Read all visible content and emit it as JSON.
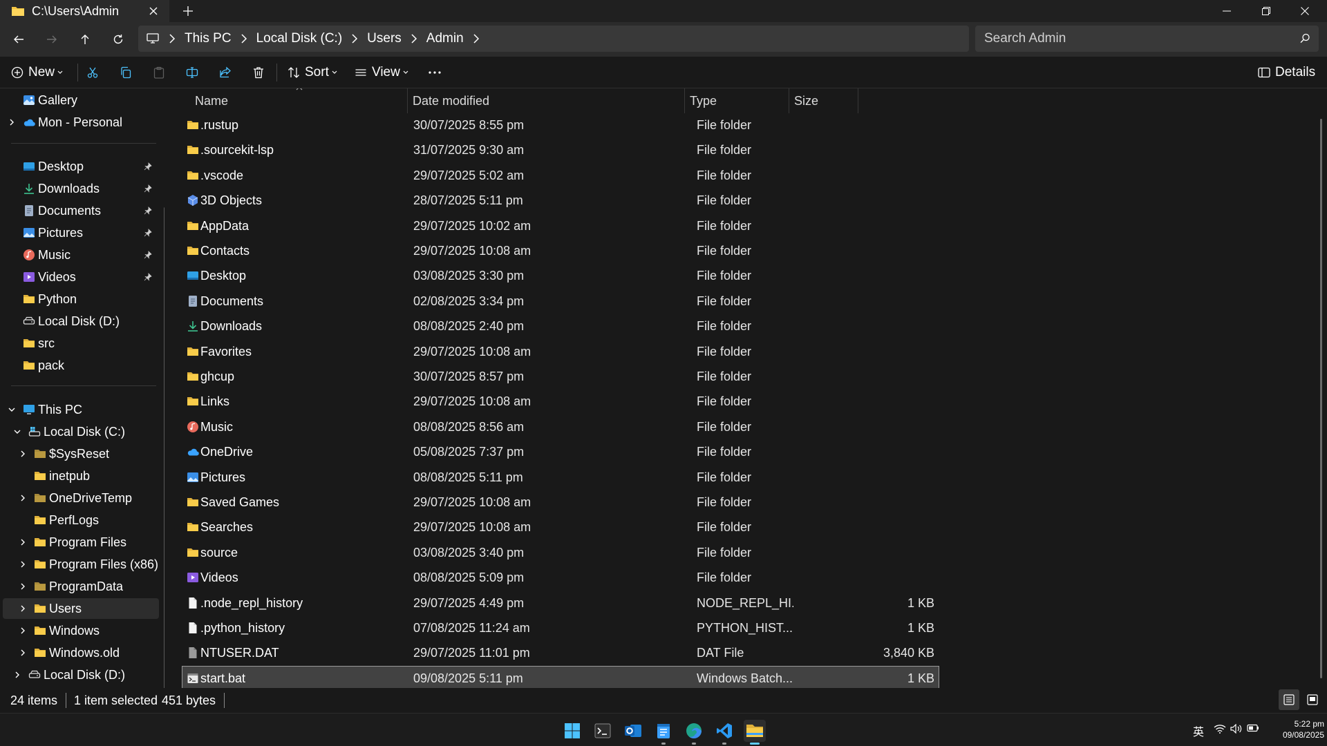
{
  "window": {
    "tab_title": "C:\\Users\\Admin"
  },
  "address": {
    "crumbs": [
      "This PC",
      "Local Disk (C:)",
      "Users",
      "Admin"
    ],
    "search_placeholder": "Search Admin"
  },
  "commandbar": {
    "new_label": "New",
    "sort_label": "Sort",
    "view_label": "View",
    "details_label": "Details"
  },
  "sidebar": {
    "items": [
      {
        "label": "Gallery",
        "icon": "gallery-icon"
      },
      {
        "label": "Mon - Personal",
        "icon": "onedrive-icon"
      },
      {
        "label": "Desktop",
        "icon": "desktop-icon"
      },
      {
        "label": "Downloads",
        "icon": "downloads-icon"
      },
      {
        "label": "Documents",
        "icon": "documents-icon"
      },
      {
        "label": "Pictures",
        "icon": "pictures-icon"
      },
      {
        "label": "Music",
        "icon": "music-icon"
      },
      {
        "label": "Videos",
        "icon": "videos-icon"
      },
      {
        "label": "Python",
        "icon": "folder-icon"
      },
      {
        "label": "Local Disk (D:)",
        "icon": "drive-icon"
      },
      {
        "label": "src",
        "icon": "folder-icon"
      },
      {
        "label": "pack",
        "icon": "folder-icon"
      },
      {
        "label": "This PC",
        "icon": "this-pc-icon"
      },
      {
        "label": "Local Disk (C:)",
        "icon": "system-drive-icon"
      },
      {
        "label": "$SysReset",
        "icon": "folder-icon"
      },
      {
        "label": "inetpub",
        "icon": "folder-icon"
      },
      {
        "label": "OneDriveTemp",
        "icon": "folder-icon"
      },
      {
        "label": "PerfLogs",
        "icon": "folder-icon"
      },
      {
        "label": "Program Files",
        "icon": "folder-icon"
      },
      {
        "label": "Program Files (x86)",
        "icon": "folder-icon"
      },
      {
        "label": "ProgramData",
        "icon": "folder-icon"
      },
      {
        "label": "Users",
        "icon": "folder-icon"
      },
      {
        "label": "Windows",
        "icon": "folder-icon"
      },
      {
        "label": "Windows.old",
        "icon": "folder-icon"
      },
      {
        "label": "Local Disk (D:)",
        "icon": "drive-icon"
      }
    ]
  },
  "columns": {
    "name": "Name",
    "date": "Date modified",
    "type": "Type",
    "size": "Size"
  },
  "files": [
    {
      "name": ".rustup",
      "date": "30/07/2025 8:55 pm",
      "type": "File folder",
      "size": "",
      "icon": "folder-icon"
    },
    {
      "name": ".sourcekit-lsp",
      "date": "31/07/2025 9:30 am",
      "type": "File folder",
      "size": "",
      "icon": "folder-icon"
    },
    {
      "name": ".vscode",
      "date": "29/07/2025 5:02 am",
      "type": "File folder",
      "size": "",
      "icon": "folder-icon"
    },
    {
      "name": "3D Objects",
      "date": "28/07/2025 5:11 pm",
      "type": "File folder",
      "size": "",
      "icon": "3d-objects-icon"
    },
    {
      "name": "AppData",
      "date": "29/07/2025 10:02 am",
      "type": "File folder",
      "size": "",
      "icon": "folder-icon"
    },
    {
      "name": "Contacts",
      "date": "29/07/2025 10:08 am",
      "type": "File folder",
      "size": "",
      "icon": "folder-icon"
    },
    {
      "name": "Desktop",
      "date": "03/08/2025 3:30 pm",
      "type": "File folder",
      "size": "",
      "icon": "desktop-icon"
    },
    {
      "name": "Documents",
      "date": "02/08/2025 3:34 pm",
      "type": "File folder",
      "size": "",
      "icon": "documents-icon"
    },
    {
      "name": "Downloads",
      "date": "08/08/2025 2:40 pm",
      "type": "File folder",
      "size": "",
      "icon": "downloads-icon"
    },
    {
      "name": "Favorites",
      "date": "29/07/2025 10:08 am",
      "type": "File folder",
      "size": "",
      "icon": "folder-icon"
    },
    {
      "name": "ghcup",
      "date": "30/07/2025 8:57 pm",
      "type": "File folder",
      "size": "",
      "icon": "folder-icon"
    },
    {
      "name": "Links",
      "date": "29/07/2025 10:08 am",
      "type": "File folder",
      "size": "",
      "icon": "folder-icon"
    },
    {
      "name": "Music",
      "date": "08/08/2025 8:56 am",
      "type": "File folder",
      "size": "",
      "icon": "music-icon"
    },
    {
      "name": "OneDrive",
      "date": "05/08/2025 7:37 pm",
      "type": "File folder",
      "size": "",
      "icon": "onedrive-icon"
    },
    {
      "name": "Pictures",
      "date": "08/08/2025 5:11 pm",
      "type": "File folder",
      "size": "",
      "icon": "pictures-icon"
    },
    {
      "name": "Saved Games",
      "date": "29/07/2025 10:08 am",
      "type": "File folder",
      "size": "",
      "icon": "folder-icon"
    },
    {
      "name": "Searches",
      "date": "29/07/2025 10:08 am",
      "type": "File folder",
      "size": "",
      "icon": "folder-icon"
    },
    {
      "name": "source",
      "date": "03/08/2025 3:40 pm",
      "type": "File folder",
      "size": "",
      "icon": "folder-icon"
    },
    {
      "name": "Videos",
      "date": "08/08/2025 5:09 pm",
      "type": "File folder",
      "size": "",
      "icon": "videos-icon"
    },
    {
      "name": ".node_repl_history",
      "date": "29/07/2025 4:49 pm",
      "type": "NODE_REPL_HI...",
      "size": "1 KB",
      "icon": "file-icon"
    },
    {
      "name": ".python_history",
      "date": "07/08/2025 11:24 am",
      "type": "PYTHON_HIST...",
      "size": "1 KB",
      "icon": "file-icon"
    },
    {
      "name": "NTUSER.DAT",
      "date": "29/07/2025 11:01 pm",
      "type": "DAT File",
      "size": "3,840 KB",
      "icon": "system-file-icon"
    },
    {
      "name": "start.bat",
      "date": "09/08/2025 5:11 pm",
      "type": "Windows Batch...",
      "size": "1 KB",
      "icon": "batch-file-icon",
      "selected": true
    }
  ],
  "status": {
    "count": "24 items",
    "selected": "1 item selected",
    "size": "451 bytes"
  },
  "tray": {
    "ime": "英",
    "time": "5:22 pm",
    "date": "09/08/2025"
  },
  "colors": {
    "folder": "#f4c542",
    "accent": "#60cdff",
    "background": "#191919"
  }
}
